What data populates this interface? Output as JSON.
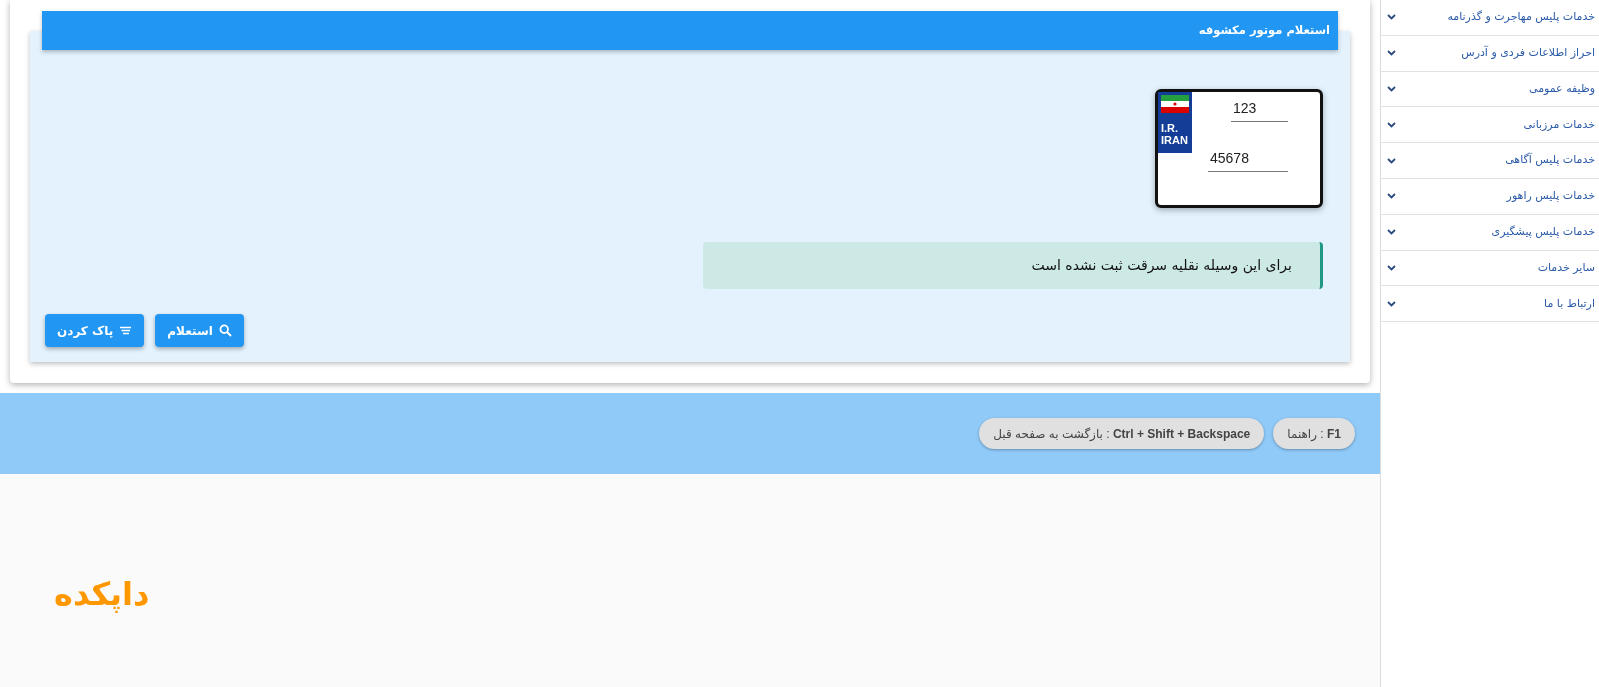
{
  "sidebar": {
    "items": [
      {
        "label": "خدمات پلیس مهاجرت و گذرنامه",
        "expanded": false
      },
      {
        "label": "احراز اطلاعات فردی و آدرس",
        "expanded": false
      },
      {
        "label": "وظیفه عمومی",
        "expanded": false
      },
      {
        "label": "خدمات مرزبانی",
        "expanded": false
      },
      {
        "label": "خدمات پلیس آگاهی",
        "expanded": false
      },
      {
        "label": "خدمات پلیس راهور",
        "expanded": false
      },
      {
        "label": "خدمات پلیس پیشگیری",
        "expanded": false
      },
      {
        "label": "سایر خدمات",
        "expanded": false
      },
      {
        "label": "ارتباط با ما",
        "expanded": false
      }
    ]
  },
  "panel": {
    "title": "استعلام موتور مکشوفه",
    "plate": {
      "country_lines": [
        "I.R.",
        "IRAN"
      ],
      "fields": [
        {
          "value": "123"
        },
        {
          "value": "45678"
        }
      ]
    },
    "alert": {
      "text": "برای این وسیله نقلیه سرقت ثبت نشده است"
    },
    "buttons": [
      {
        "label": "استعلام",
        "kind": "search"
      },
      {
        "label": "پاک کردن",
        "kind": "clear"
      }
    ]
  },
  "shortcuts": [
    {
      "text": "**F1** : راهنما"
    },
    {
      "text": "**Ctrl + Shift + Backspace** : بازگشت به صفحه قبل"
    }
  ],
  "logo": {
    "text": "داپکده"
  }
}
